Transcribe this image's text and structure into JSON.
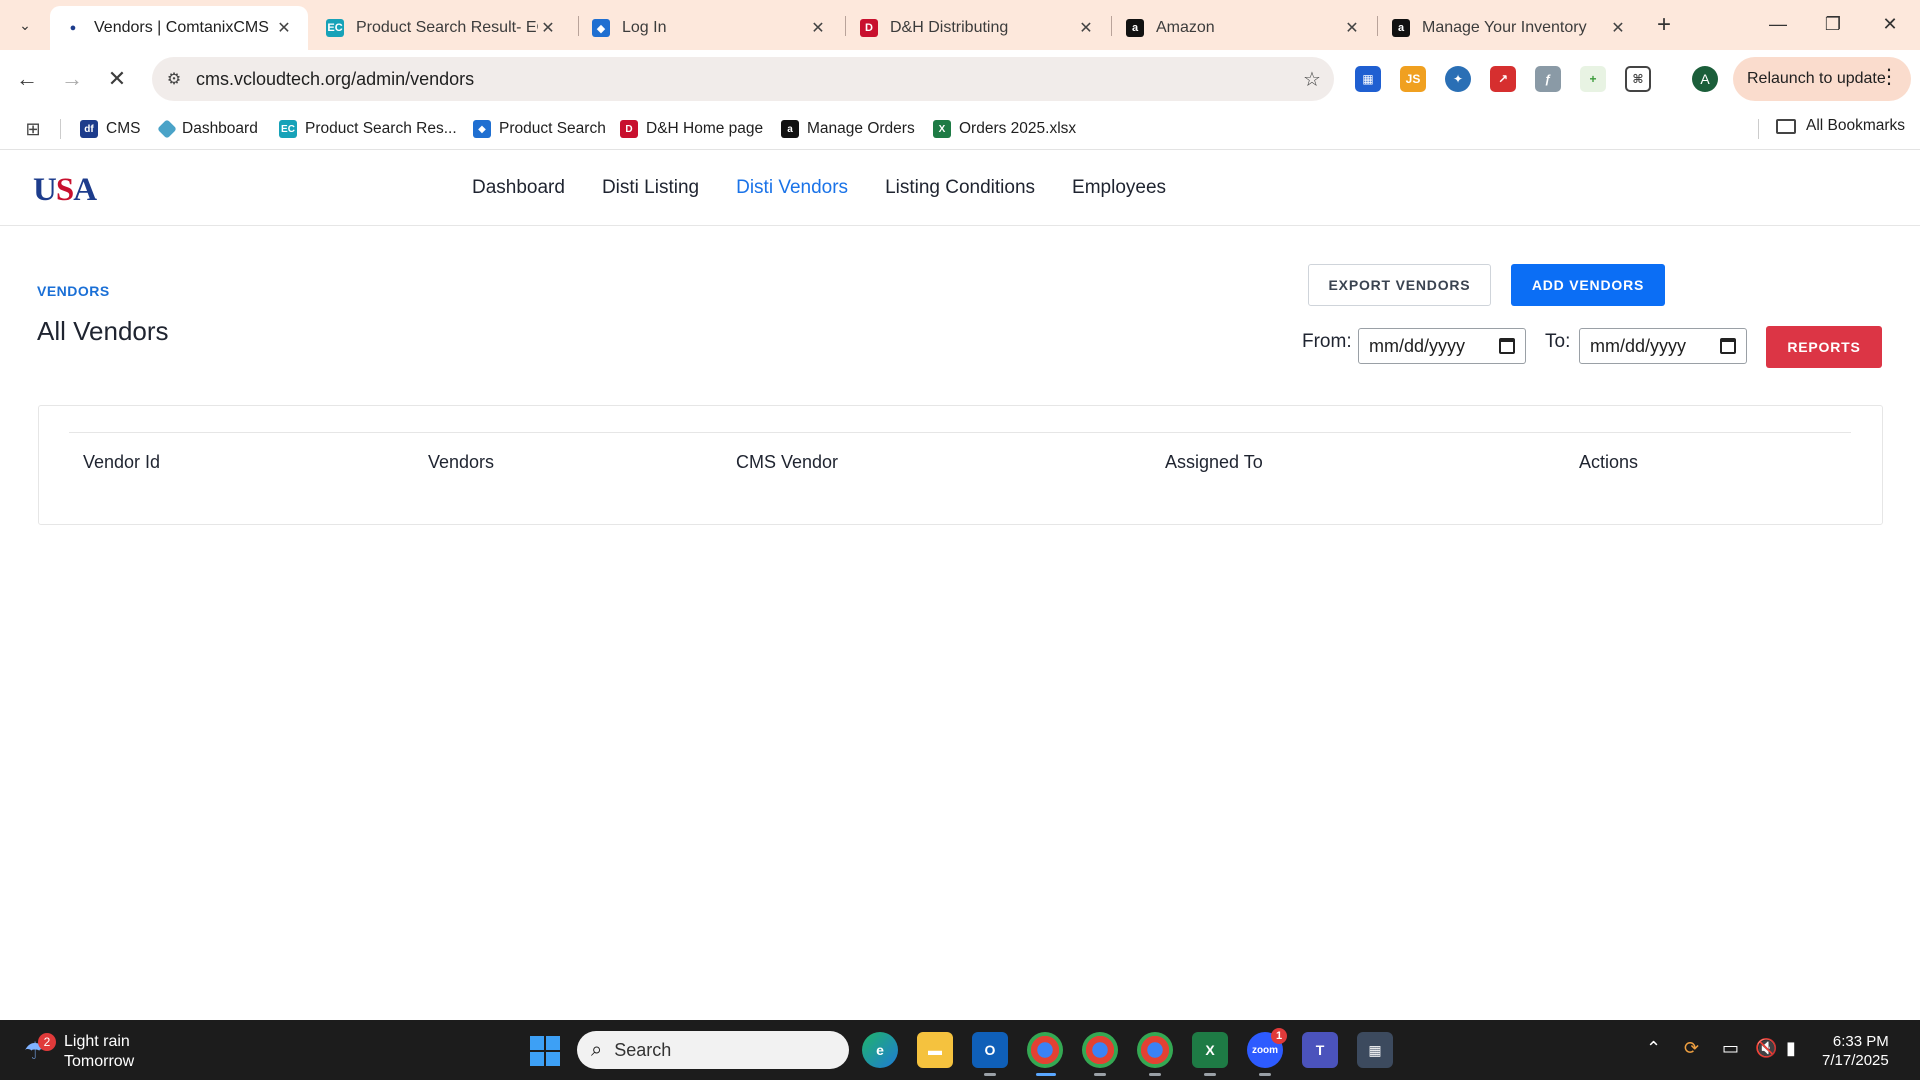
{
  "browser": {
    "tabs": [
      {
        "title": "Vendors | ComtanixCMS",
        "active": true
      },
      {
        "title": "Product Search Result- ECD"
      },
      {
        "title": "Log In"
      },
      {
        "title": "D&H Distributing"
      },
      {
        "title": "Amazon"
      },
      {
        "title": "Manage Your Inventory"
      }
    ],
    "url": "cms.vcloudtech.org/admin/vendors",
    "relaunch_label": "Relaunch to update",
    "avatar_letter": "A",
    "bookmarks": [
      {
        "label": "CMS"
      },
      {
        "label": "Dashboard"
      },
      {
        "label": "Product Search Res..."
      },
      {
        "label": "Product Search"
      },
      {
        "label": "D&H Home page"
      },
      {
        "label": "Manage Orders"
      },
      {
        "label": "Orders 2025.xlsx"
      }
    ],
    "all_bookmarks_label": "All Bookmarks"
  },
  "site": {
    "logo_parts": [
      "U",
      "S",
      "A"
    ],
    "nav": [
      {
        "label": "Dashboard"
      },
      {
        "label": "Disti Listing"
      },
      {
        "label": "Disti Vendors",
        "active": true
      },
      {
        "label": "Listing Conditions"
      },
      {
        "label": "Employees"
      }
    ]
  },
  "page": {
    "breadcrumb": "VENDORS",
    "title": "All Vendors",
    "export_label": "EXPORT VENDORS",
    "add_label": "ADD VENDORS",
    "reports_label": "REPORTS",
    "from_label": "From:",
    "to_label": "To:",
    "date_placeholder": "mm/dd/yyyy",
    "table_headers": [
      "Vendor Id",
      "Vendors",
      "CMS Vendor",
      "Assigned To",
      "Actions"
    ]
  },
  "taskbar": {
    "weather_badge": "2",
    "weather_line1": "Light rain",
    "weather_line2": "Tomorrow",
    "search_label": "Search",
    "zoom_badge": "1",
    "time": "6:33 PM",
    "date": "7/17/2025"
  },
  "colors": {
    "accent": "#1a73e8",
    "primary_button": "#0b6ef5",
    "danger_button": "#dc3545",
    "tabstrip": "#fde8dc"
  }
}
